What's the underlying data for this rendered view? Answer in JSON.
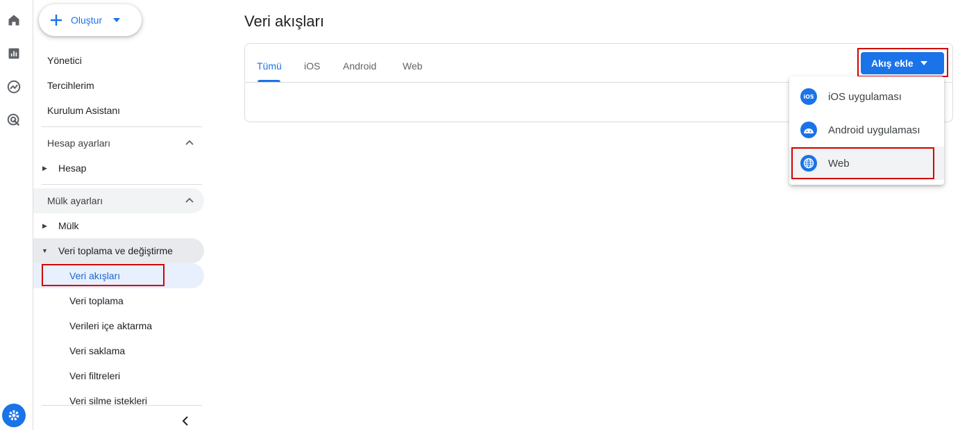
{
  "rail": {
    "icons": [
      "home-icon",
      "reports-icon",
      "explore-icon",
      "advertising-icon"
    ],
    "settings_icon": "gear-icon"
  },
  "sidebar": {
    "create_label": "Oluştur",
    "items": [
      "Yönetici",
      "Tercihlerim",
      "Kurulum Asistanı"
    ],
    "account_section": {
      "title": "Hesap ayarları",
      "items": [
        "Hesap"
      ]
    },
    "property_section": {
      "title": "Mülk ayarları",
      "items": [
        "Mülk"
      ],
      "group": {
        "title": "Veri toplama ve değiştirme",
        "items": [
          "Veri akışları",
          "Veri toplama",
          "Verileri içe aktarma",
          "Veri saklama",
          "Veri filtreleri",
          "Veri silme istekleri"
        ],
        "active": "Veri akışları"
      }
    }
  },
  "main": {
    "title": "Veri akışları",
    "tabs": [
      {
        "label": "Tümü",
        "selected": true
      },
      {
        "label": "iOS",
        "selected": false
      },
      {
        "label": "Android",
        "selected": false
      },
      {
        "label": "Web",
        "selected": false
      }
    ],
    "add_button": "Akış ekle",
    "menu": [
      {
        "label": "iOS uygulaması",
        "icon": "ios-icon"
      },
      {
        "label": "Android uygulaması",
        "icon": "android-icon"
      },
      {
        "label": "Web",
        "icon": "globe-icon"
      }
    ]
  },
  "colors": {
    "accent": "#1a73e8",
    "highlight": "#d50000",
    "active_bg": "#e8f0fe"
  }
}
